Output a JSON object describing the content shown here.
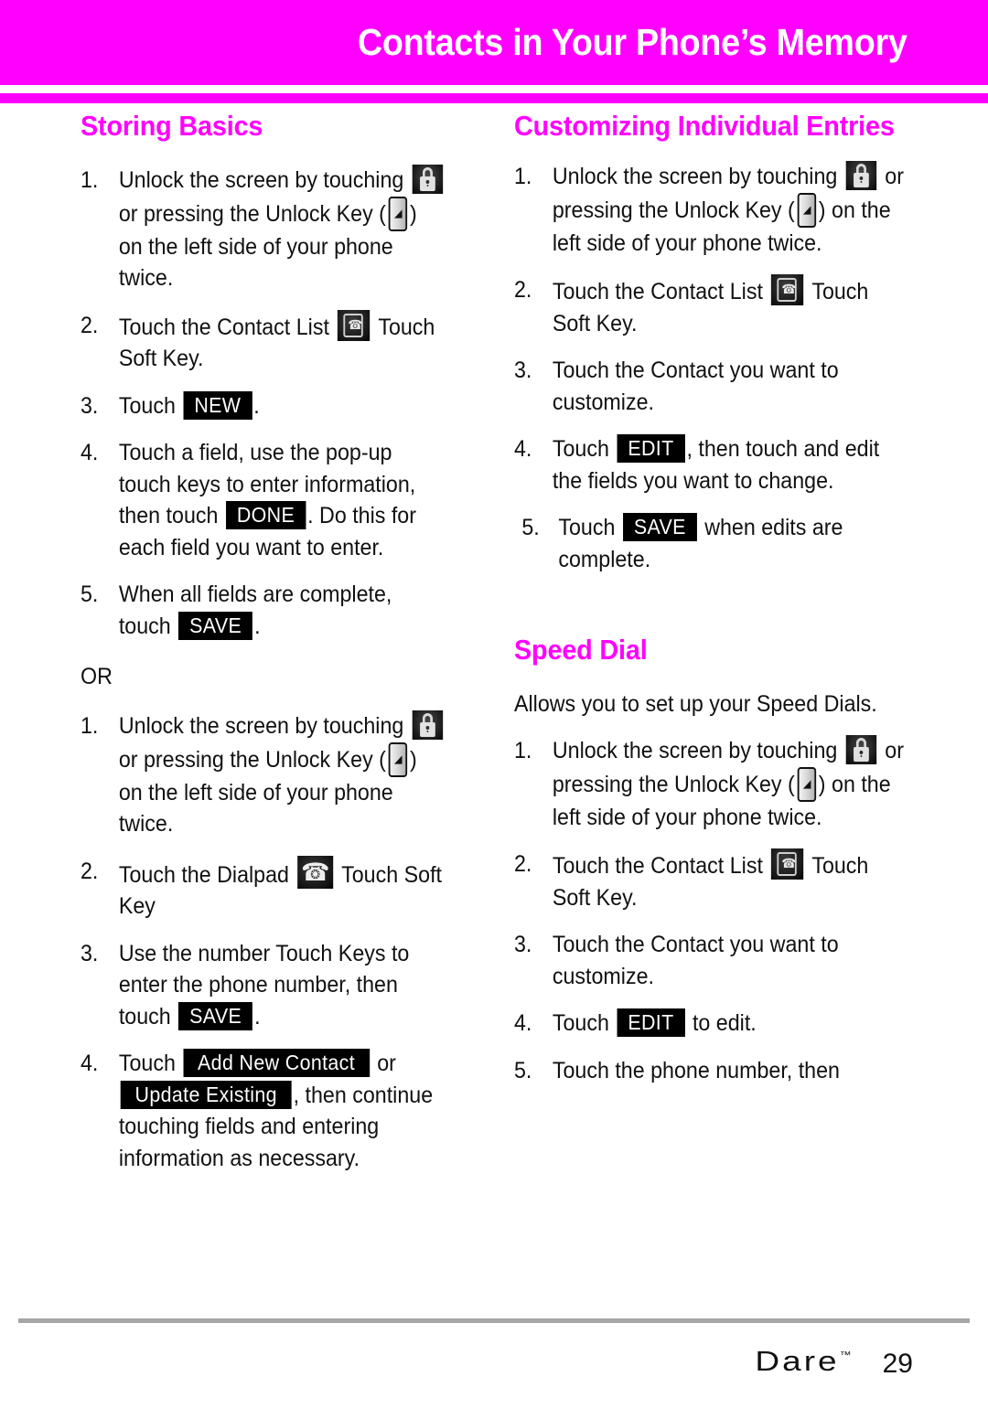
{
  "header": {
    "title": "Contacts in Your Phone’s Memory",
    "band_color": "#ff00ff",
    "title_color": "#ffffff"
  },
  "footer": {
    "brand": "Dare",
    "trademark": "™",
    "page_number": "29"
  },
  "icons": {
    "lock": "lock-icon",
    "unlock_key": "unlock-key-icon",
    "contact_list": "contact-list-icon",
    "dialpad": "dialpad-icon"
  },
  "left_column": {
    "section_title": "Storing Basics",
    "steps_a": [
      {
        "num": "1.",
        "parts": [
          {
            "t": "text",
            "v": "Unlock the screen by touching "
          },
          {
            "t": "icon",
            "v": "lock-icon"
          },
          {
            "t": "text",
            "v": " or pressing the Unlock Key ("
          },
          {
            "t": "icon",
            "v": "unlock-key-icon"
          },
          {
            "t": "text",
            "v": ") on the left side of your phone twice."
          }
        ]
      },
      {
        "num": "2.",
        "parts": [
          {
            "t": "text",
            "v": "Touch the Contact List "
          },
          {
            "t": "icon",
            "v": "contact-list-icon"
          },
          {
            "t": "text",
            "v": " Touch Soft Key."
          }
        ]
      },
      {
        "num": "3.",
        "parts": [
          {
            "t": "text",
            "v": "Touch "
          },
          {
            "t": "key",
            "v": "NEW"
          },
          {
            "t": "text",
            "v": "."
          }
        ]
      },
      {
        "num": "4.",
        "parts": [
          {
            "t": "text",
            "v": "Touch a field, use the pop-up touch keys to enter information, then touch "
          },
          {
            "t": "key",
            "v": "DONE"
          },
          {
            "t": "text",
            "v": ". Do this for each field you want to enter."
          }
        ]
      },
      {
        "num": "5.",
        "parts": [
          {
            "t": "text",
            "v": "When all fields are complete, touch "
          },
          {
            "t": "key",
            "v": "SAVE"
          },
          {
            "t": "text",
            "v": "."
          }
        ]
      }
    ],
    "or_label": "OR",
    "steps_b": [
      {
        "num": "1.",
        "parts": [
          {
            "t": "text",
            "v": "Unlock the screen by touching "
          },
          {
            "t": "icon",
            "v": "lock-icon"
          },
          {
            "t": "text",
            "v": " or pressing the Unlock Key ("
          },
          {
            "t": "icon",
            "v": "unlock-key-icon"
          },
          {
            "t": "text",
            "v": ") on the left side of your phone twice."
          }
        ]
      },
      {
        "num": "2.",
        "parts": [
          {
            "t": "text",
            "v": "Touch the Dialpad "
          },
          {
            "t": "icon",
            "v": "dialpad-icon"
          },
          {
            "t": "text",
            "v": " Touch Soft Key"
          }
        ]
      },
      {
        "num": "3.",
        "parts": [
          {
            "t": "text",
            "v": "Use the number Touch Keys to enter the phone number, then touch "
          },
          {
            "t": "key",
            "v": "SAVE"
          },
          {
            "t": "text",
            "v": "."
          }
        ]
      },
      {
        "num": "4.",
        "parts": [
          {
            "t": "text",
            "v": "Touch "
          },
          {
            "t": "key",
            "v": "Add New Contact"
          },
          {
            "t": "text",
            "v": " or "
          },
          {
            "t": "key",
            "v": "Update Existing"
          },
          {
            "t": "text",
            "v": ", then continue touching fields and entering information as necessary."
          }
        ]
      }
    ]
  },
  "right_column": {
    "section_title_1": "Customizing Individual Entries",
    "steps_1": [
      {
        "num": "1.",
        "parts": [
          {
            "t": "text",
            "v": "Unlock the screen by touching "
          },
          {
            "t": "icon",
            "v": "lock-icon"
          },
          {
            "t": "text",
            "v": " or pressing the Unlock Key ("
          },
          {
            "t": "icon",
            "v": "unlock-key-icon"
          },
          {
            "t": "text",
            "v": ") on the left side of your phone twice."
          }
        ]
      },
      {
        "num": "2.",
        "parts": [
          {
            "t": "text",
            "v": "Touch the Contact List "
          },
          {
            "t": "icon",
            "v": "contact-list-icon"
          },
          {
            "t": "text",
            "v": " Touch Soft Key."
          }
        ]
      },
      {
        "num": "3.",
        "parts": [
          {
            "t": "text",
            "v": "Touch the Contact you want to customize."
          }
        ]
      },
      {
        "num": "4.",
        "parts": [
          {
            "t": "text",
            "v": "Touch "
          },
          {
            "t": "key",
            "v": "EDIT"
          },
          {
            "t": "text",
            "v": ", then touch and edit the fields you want to change."
          }
        ]
      },
      {
        "num": "5.",
        "parts": [
          {
            "t": "text",
            "v": "Touch "
          },
          {
            "t": "key",
            "v": "SAVE"
          },
          {
            "t": "text",
            "v": " when edits are complete."
          }
        ]
      }
    ],
    "section_title_2": "Speed Dial",
    "intro_2": "Allows you to set up your Speed Dials.",
    "steps_2": [
      {
        "num": "1.",
        "parts": [
          {
            "t": "text",
            "v": "Unlock the screen by touching "
          },
          {
            "t": "icon",
            "v": "lock-icon"
          },
          {
            "t": "text",
            "v": " or pressing the Unlock Key ("
          },
          {
            "t": "icon",
            "v": "unlock-key-icon"
          },
          {
            "t": "text",
            "v": ") on the left side of your phone twice."
          }
        ]
      },
      {
        "num": "2.",
        "parts": [
          {
            "t": "text",
            "v": "Touch the Contact List "
          },
          {
            "t": "icon",
            "v": "contact-list-icon"
          },
          {
            "t": "text",
            "v": " Touch Soft Key."
          }
        ]
      },
      {
        "num": "3.",
        "parts": [
          {
            "t": "text",
            "v": "Touch the Contact you want to customize."
          }
        ]
      },
      {
        "num": "4.",
        "parts": [
          {
            "t": "text",
            "v": "Touch "
          },
          {
            "t": "key",
            "v": "EDIT"
          },
          {
            "t": "text",
            "v": " to edit."
          }
        ]
      },
      {
        "num": "5.",
        "parts": [
          {
            "t": "text",
            "v": "Touch the phone number, then"
          }
        ]
      }
    ]
  }
}
